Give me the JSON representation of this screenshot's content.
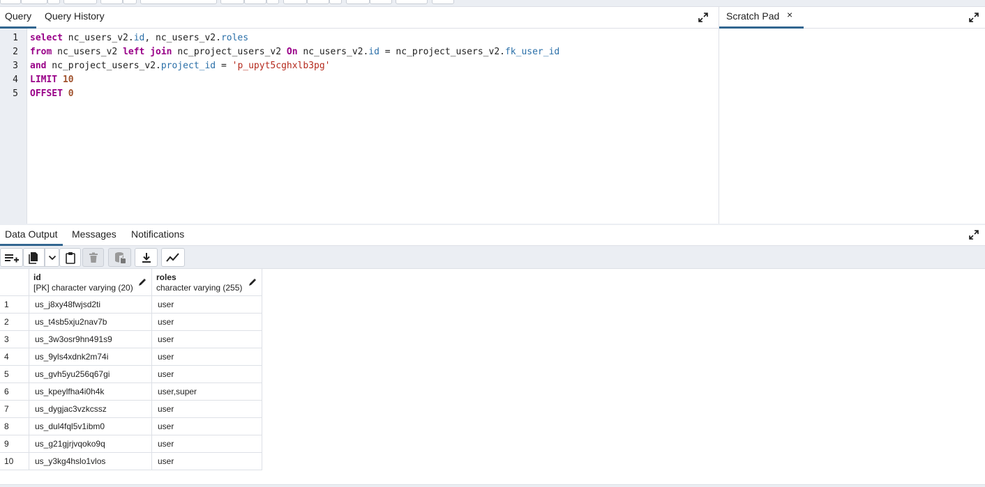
{
  "query_panel": {
    "tabs": [
      {
        "label": "Query",
        "active": true
      },
      {
        "label": "Query History",
        "active": false
      }
    ]
  },
  "scratch_panel": {
    "tab_label": "Scratch Pad",
    "close_symbol": "×"
  },
  "editor": {
    "line_numbers": [
      "1",
      "2",
      "3",
      "4",
      "5"
    ],
    "lines": [
      [
        {
          "t": "select",
          "c": "kw"
        },
        {
          "t": " nc_users_v2.",
          "c": ""
        },
        {
          "t": "id",
          "c": "prop"
        },
        {
          "t": ", nc_users_v2.",
          "c": ""
        },
        {
          "t": "roles",
          "c": "prop"
        }
      ],
      [
        {
          "t": "from",
          "c": "kw"
        },
        {
          "t": " nc_users_v2 ",
          "c": ""
        },
        {
          "t": "left join",
          "c": "kw"
        },
        {
          "t": " nc_project_users_v2 ",
          "c": ""
        },
        {
          "t": "On",
          "c": "kw"
        },
        {
          "t": " nc_users_v2.",
          "c": ""
        },
        {
          "t": "id",
          "c": "prop"
        },
        {
          "t": " = nc_project_users_v2.",
          "c": ""
        },
        {
          "t": "fk_user_id",
          "c": "prop"
        }
      ],
      [
        {
          "t": "and",
          "c": "kw"
        },
        {
          "t": " nc_project_users_v2.",
          "c": ""
        },
        {
          "t": "project_id",
          "c": "prop"
        },
        {
          "t": " = ",
          "c": ""
        },
        {
          "t": "'p_upyt5cghxlb3pg'",
          "c": "str"
        }
      ],
      [
        {
          "t": "LIMIT",
          "c": "kw"
        },
        {
          "t": " ",
          "c": ""
        },
        {
          "t": "10",
          "c": "num"
        }
      ],
      [
        {
          "t": "OFFSET",
          "c": "kw"
        },
        {
          "t": " ",
          "c": ""
        },
        {
          "t": "0",
          "c": "num"
        }
      ]
    ]
  },
  "output_panel": {
    "tabs": [
      {
        "label": "Data Output",
        "active": true
      },
      {
        "label": "Messages",
        "active": false
      },
      {
        "label": "Notifications",
        "active": false
      }
    ],
    "toolbar_icons": [
      "add-row-icon",
      "copy-icon",
      "dropdown-chevron-icon",
      "paste-icon",
      "delete-icon",
      "save-data-icon",
      "download-icon",
      "graph-icon"
    ]
  },
  "grid": {
    "columns": [
      {
        "name": "id",
        "type": "[PK] character varying (20)"
      },
      {
        "name": "roles",
        "type": "character varying (255)"
      }
    ],
    "rows": [
      {
        "n": "1",
        "id": "us_j8xy48fwjsd2ti",
        "roles": "user"
      },
      {
        "n": "2",
        "id": "us_t4sb5xju2nav7b",
        "roles": "user"
      },
      {
        "n": "3",
        "id": "us_3w3osr9hn491s9",
        "roles": "user"
      },
      {
        "n": "4",
        "id": "us_9yls4xdnk2m74i",
        "roles": "user"
      },
      {
        "n": "5",
        "id": "us_gvh5yu256q67gi",
        "roles": "user"
      },
      {
        "n": "6",
        "id": "us_kpeylfha4i0h4k",
        "roles": "user,super"
      },
      {
        "n": "7",
        "id": "us_dygjac3vzkcssz",
        "roles": "user"
      },
      {
        "n": "8",
        "id": "us_dul4fql5v1ibm0",
        "roles": "user"
      },
      {
        "n": "9",
        "id": "us_g21gjrjvqoko9q",
        "roles": "user"
      },
      {
        "n": "10",
        "id": "us_y3kg4hslo1vlos",
        "roles": "user"
      }
    ]
  },
  "colors": {
    "accent": "#326690",
    "keyword": "#990088",
    "property": "#2a6fa8",
    "string": "#b52a1d",
    "number": "#a0522d"
  }
}
